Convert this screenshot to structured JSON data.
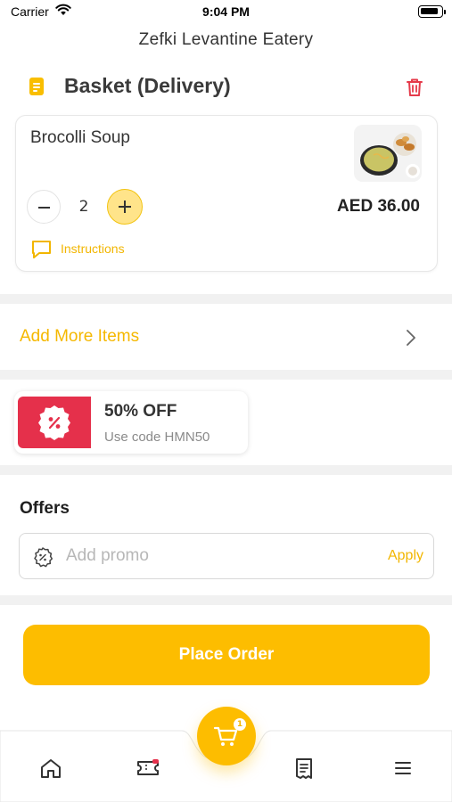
{
  "status_bar": {
    "carrier": "Carrier",
    "time": "9:04 PM"
  },
  "header": {
    "restaurant_name": "Zefki Levantine Eatery"
  },
  "basket": {
    "title": "Basket (Delivery)",
    "items": [
      {
        "name": "Brocolli Soup",
        "quantity": "2",
        "price": "AED 36.00",
        "instructions_label": "Instructions"
      }
    ]
  },
  "add_more": {
    "label": "Add More Items"
  },
  "offer_card": {
    "title": "50% OFF",
    "subtitle": "Use code HMN50"
  },
  "offers": {
    "heading": "Offers",
    "promo_placeholder": "Add promo",
    "apply_label": "Apply"
  },
  "place_order": {
    "label": "Place Order"
  },
  "tabbar": {
    "items": [
      {
        "icon": "home-icon"
      },
      {
        "icon": "ticket-icon"
      },
      {
        "icon": "cart-icon",
        "badge_count": "1"
      },
      {
        "icon": "receipt-icon"
      },
      {
        "icon": "menu-icon"
      }
    ]
  },
  "colors": {
    "accent": "#fdbd00",
    "accent_text": "#f2b600",
    "offer_red": "#e5304b",
    "delete_red": "#e53a4a"
  }
}
